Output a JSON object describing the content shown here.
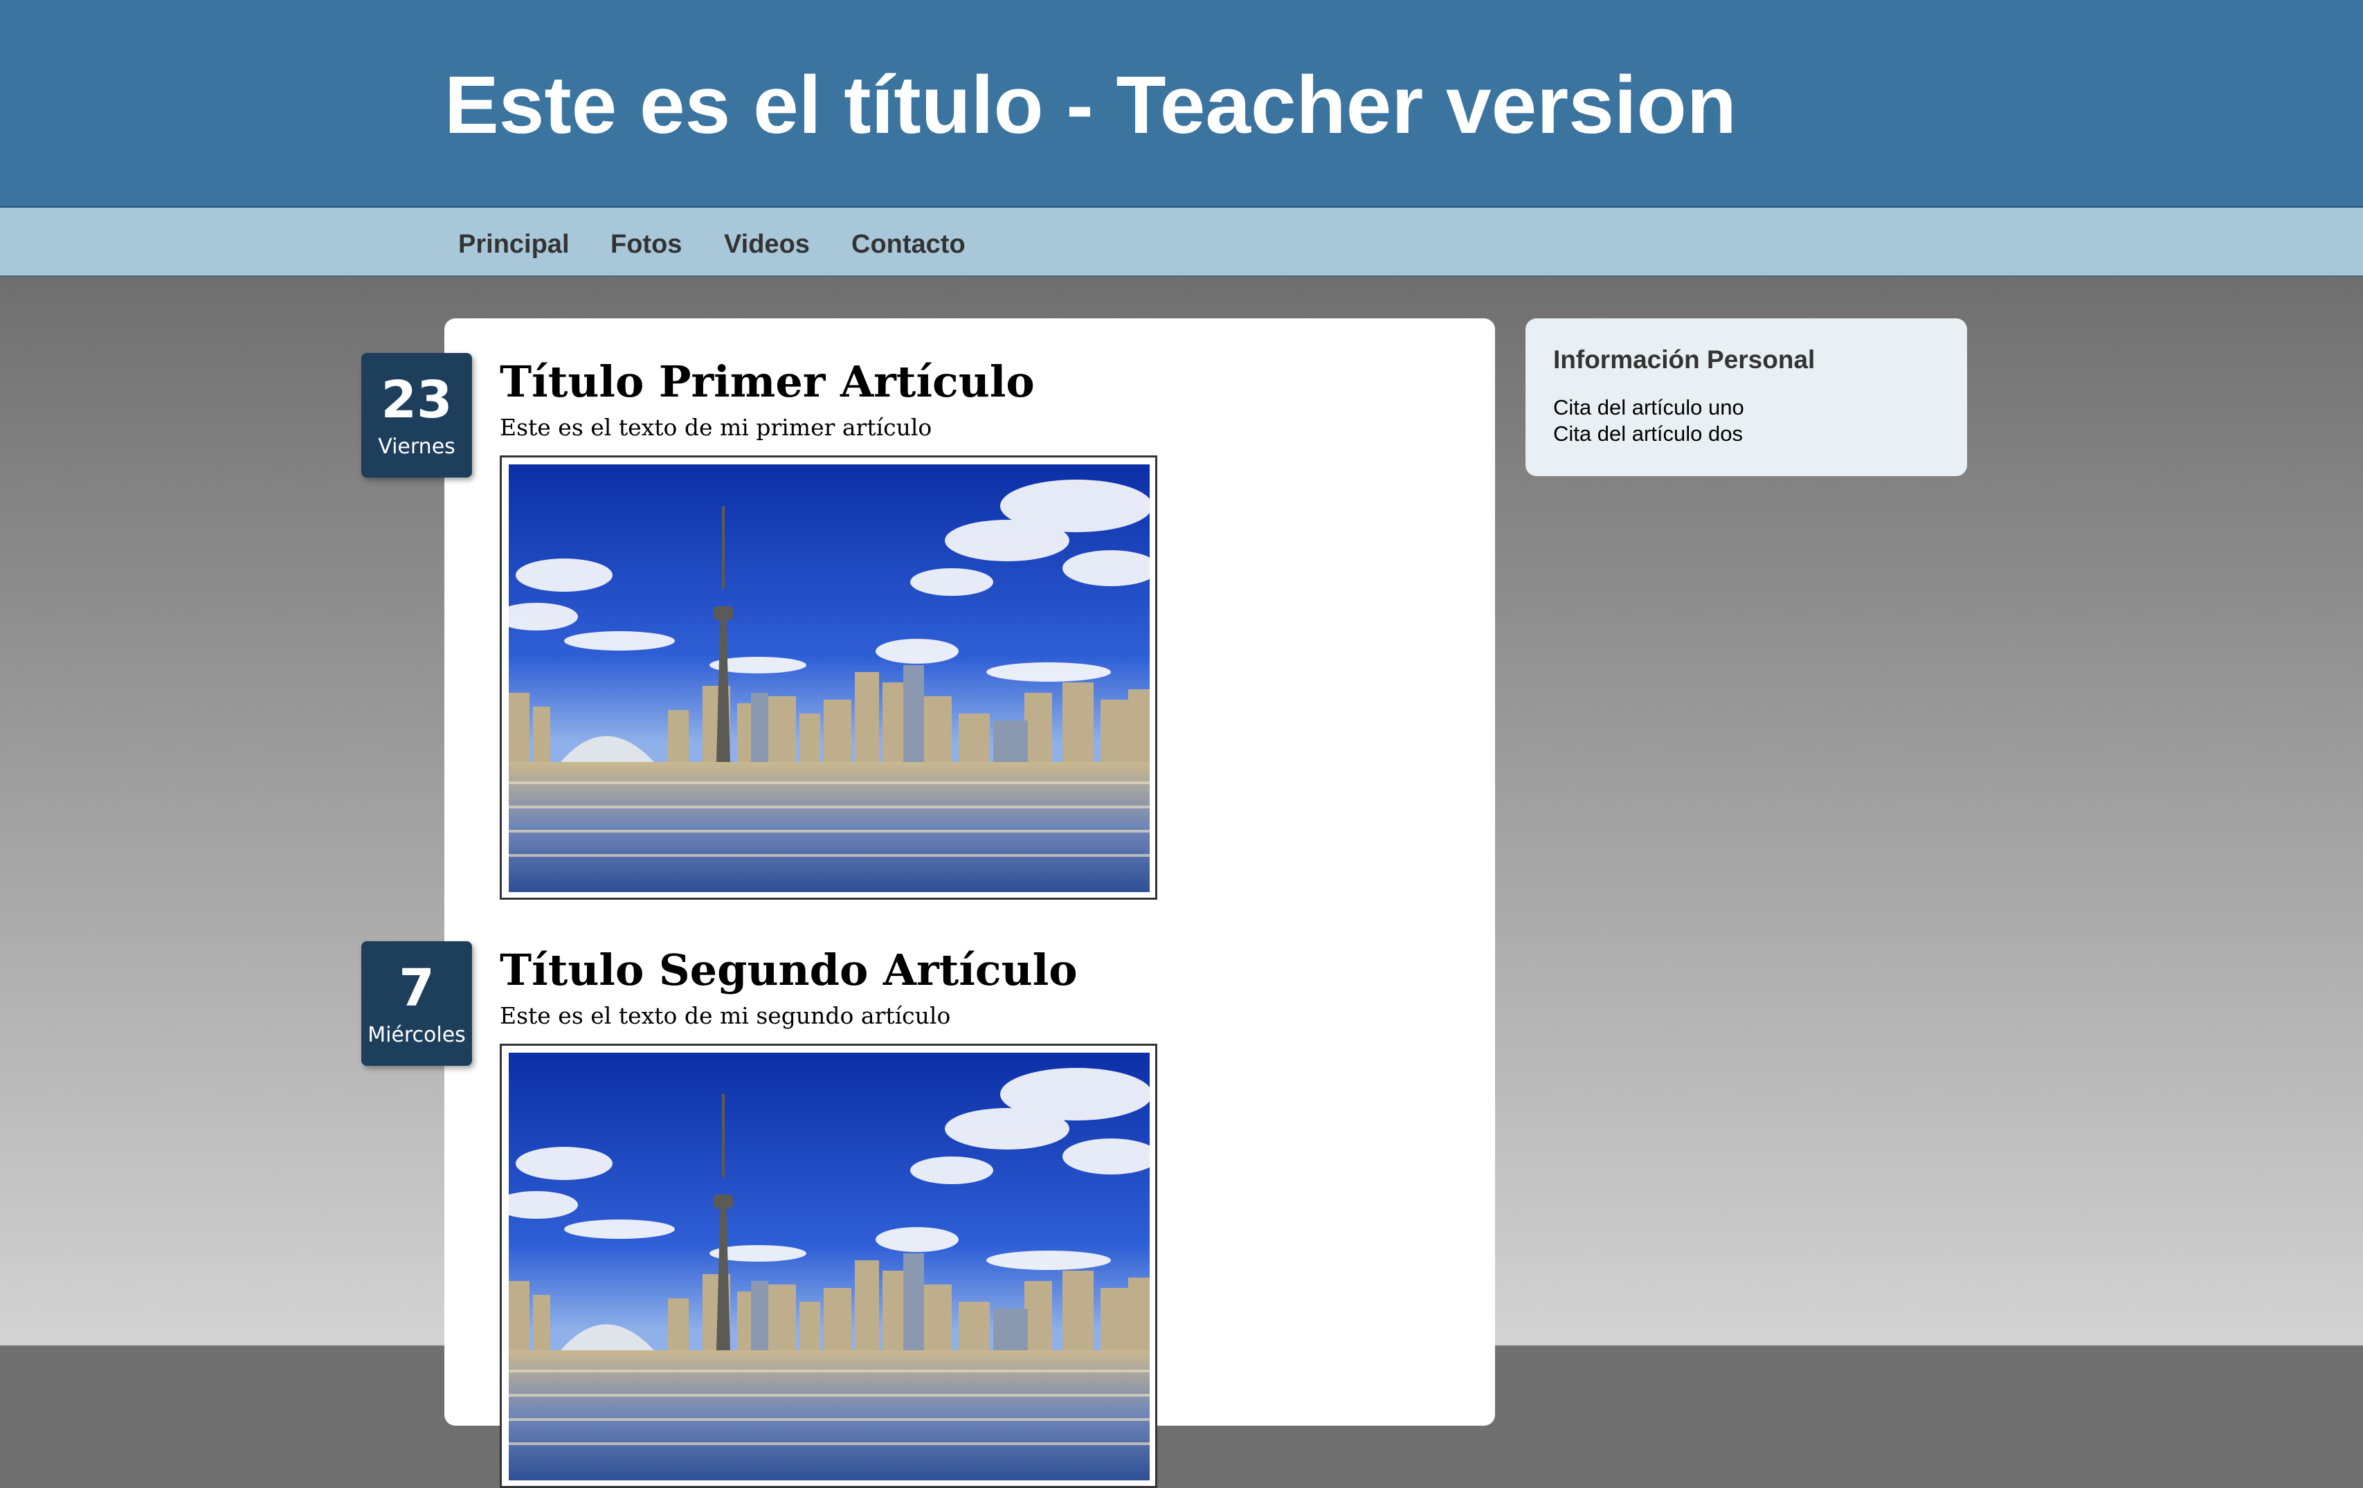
{
  "header": {
    "title": "Este es el título - Teacher version"
  },
  "nav": {
    "items": [
      {
        "label": "Principal"
      },
      {
        "label": "Fotos"
      },
      {
        "label": "Videos"
      },
      {
        "label": "Contacto"
      }
    ]
  },
  "articles": [
    {
      "day": "23",
      "weekday": "Viernes",
      "title": "Título Primer Artículo",
      "text": "Este es el texto de mi primer artículo",
      "image": "toronto-skyline-photo"
    },
    {
      "day": "7",
      "weekday": "Miércoles",
      "title": "Título Segundo Artículo",
      "text": "Este es el texto de mi segundo artículo",
      "image": "toronto-skyline-photo"
    }
  ],
  "sidebar": {
    "title": "Información Personal",
    "links": [
      {
        "label": "Cita del artículo uno"
      },
      {
        "label": "Cita del artículo dos"
      }
    ]
  }
}
